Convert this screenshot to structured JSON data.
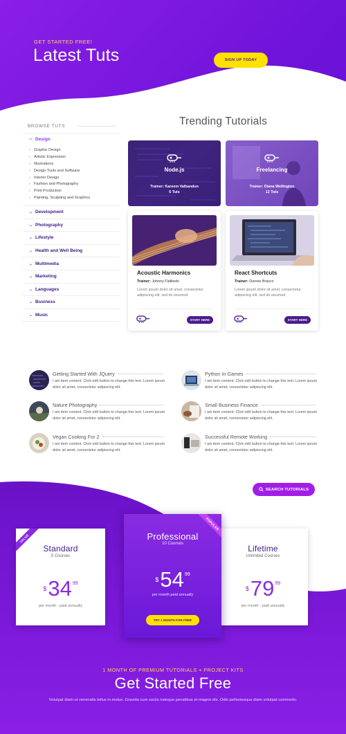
{
  "colors": {
    "brand_purple": "#7b1fe0",
    "deep_purple": "#3b1c86",
    "accent_yellow": "#ffe100",
    "eyebrow_yellow": "#ffd85a",
    "accent_violet": "#a11ee8"
  },
  "hero": {
    "eyebrow": "GET STARTED FREE!",
    "title": "Latest Tuts",
    "cta": "SIGN UP TODAY"
  },
  "sidebar": {
    "heading": "BROWSE TUTS",
    "open_category": "Design",
    "subcategories": [
      "Graphic Design",
      "Artistic Expression",
      "Illustrations",
      "Design Tools and Software",
      "Interior Design",
      "Fashion and Photography",
      "Print Production",
      "Painting, Sculpting and Graphics"
    ],
    "categories": [
      "Development",
      "Photography",
      "Lifestyle",
      "Health and Well Being",
      "Multimedia",
      "Marketing",
      "Languages",
      "Business",
      "Music"
    ]
  },
  "trending": {
    "title": "Trending Tutorials",
    "tiles": [
      {
        "name": "Node.js",
        "trainer": "Trainer: Kareem Valbandun",
        "count": "6 Tuts",
        "icon": "node-icon"
      },
      {
        "name": "Freelancing",
        "trainer": "Trainer: Diana Wellington",
        "count": "12 Tuts",
        "icon": "freelancing-icon"
      }
    ],
    "cards": [
      {
        "title": "Acoustic Harmonics",
        "trainer_label": "Trainer:",
        "trainer": "Johnny Flatbeds",
        "desc": "Lorem ipsum dolor sit amet, consectetur adipiscing elit, sed do eiusmod",
        "button": "START HERE"
      },
      {
        "title": "React Shortcuts",
        "trainer_label": "Trainer:",
        "trainer": "Donnie Brasco",
        "desc": "Lorem ipsum dolor sit amet, consectetur adipiscing elit, sed do eiusmod",
        "button": "START HERE"
      }
    ]
  },
  "articles": [
    {
      "title": "Getting Started With JQuery",
      "desc": "I am item content. Click edit button to change this text. Lorem ipsum dolor sit amet, consectetur adipiscing elit."
    },
    {
      "title": "Python In Games",
      "desc": "I am item content. Click edit button to change this text. Lorem ipsum dolor sit amet, consectetur adipiscing elit."
    },
    {
      "title": "Nature Photography",
      "desc": "I am item content. Click edit button to change this text. Lorem ipsum dolor sit amet, consectetur adipiscing elit."
    },
    {
      "title": "Small Business Finance",
      "desc": "I am item content. Click edit button to change this text. Lorem ipsum dolor sit amet, consectetur adipiscing elit."
    },
    {
      "title": "Vegan Cooking For 2",
      "desc": "I am item content. Click edit button to change this text. Lorem ipsum dolor sit amet, consectetur adipiscing elit."
    },
    {
      "title": "Successful Remote Working",
      "desc": "I am item content. Click edit button to change this text. Lorem ipsum dolor sit amet, consectetur adipiscing elit."
    }
  ],
  "search_button": "SEARCH TUTORIALS",
  "plans": [
    {
      "name": "Standard",
      "sub": "5 Courses",
      "currency": "$",
      "amount": "34",
      "cents": "99",
      "per": "per month - paid annually",
      "ribbon": "VALUE"
    },
    {
      "name": "Professional",
      "sub": "10 Courses",
      "currency": "$",
      "amount": "54",
      "cents": "99",
      "per": "per month paid annually",
      "ribbon": "POPULAR",
      "button": "TRY 1 MONTH FOR FREE"
    },
    {
      "name": "Lifetime",
      "sub": "Unlimited Courses",
      "currency": "$",
      "amount": "79",
      "cents": "99",
      "per": "per month - paid annually"
    }
  ],
  "footer": {
    "eyebrow": "1 MONTH OF PREMIUM TUTORIALS + PROJECT KITS",
    "title": "Get Started Free",
    "desc": "Volutpat diam ut venenatis tellus in metus. Gravida cum sociis natoque penatibus et magnis dis. Odio pellentesque diam volutpat commodo."
  }
}
